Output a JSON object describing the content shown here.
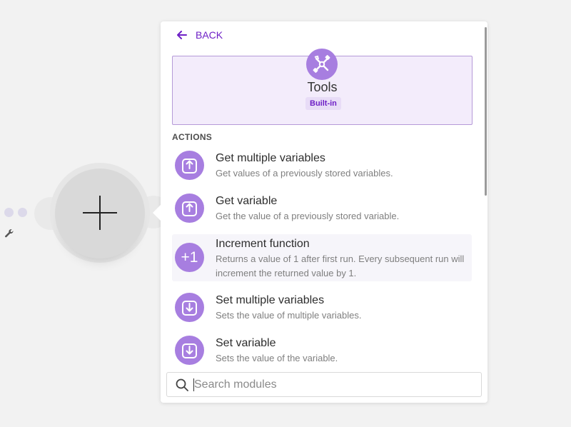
{
  "panel": {
    "back_label": "BACK",
    "app": {
      "name": "Tools",
      "badge": "Built-in",
      "icon": "tools-icon"
    },
    "section_title": "ACTIONS",
    "items": [
      {
        "title": "Get multiple variables",
        "desc": "Get values of a previously stored variables.",
        "icon": "upload-icon"
      },
      {
        "title": "Get variable",
        "desc": "Get the value of a previously stored variable.",
        "icon": "upload-icon"
      },
      {
        "title": "Increment function",
        "desc": "Returns a value of 1 after first run. Every subsequent run will increment the returned value by 1.",
        "icon": "increment-icon",
        "icon_text": "+1"
      },
      {
        "title": "Set multiple variables",
        "desc": "Sets the value of multiple variables.",
        "icon": "download-icon"
      },
      {
        "title": "Set variable",
        "desc": "Sets the value of the variable.",
        "icon": "download-icon"
      }
    ],
    "search": {
      "placeholder": "Search modules",
      "value": ""
    }
  },
  "colors": {
    "accent": "#6e20c6",
    "icon_bg": "#a77ee0",
    "card_bg": "#f3ecfb",
    "card_border": "#b59ad8"
  }
}
